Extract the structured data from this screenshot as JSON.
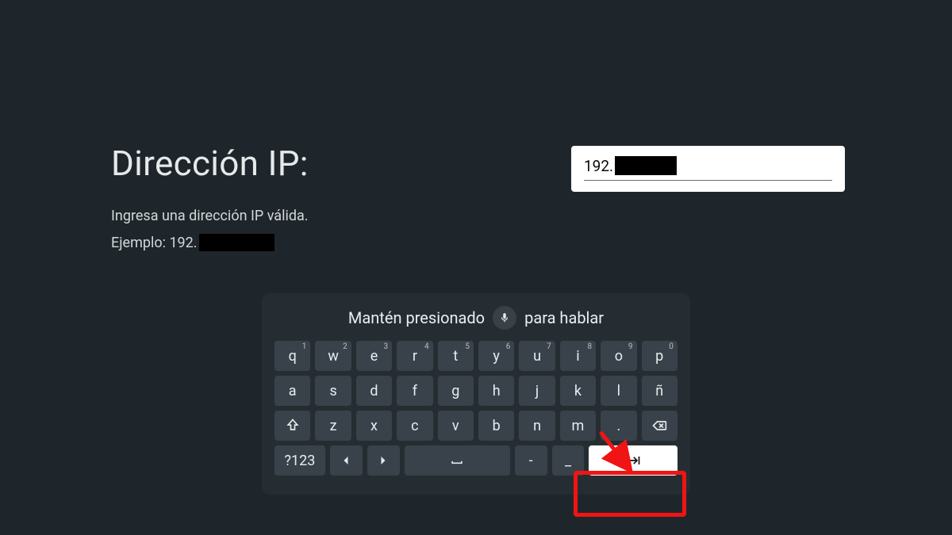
{
  "title": "Dirección IP:",
  "hint": "Ingresa una dirección IP válida.",
  "example_prefix": "Ejemplo: 192.",
  "input": {
    "value_visible": "192."
  },
  "keyboard": {
    "voice_hint_before": "Mantén presionado",
    "voice_hint_after": "para hablar",
    "row1": [
      {
        "l": "q",
        "s": "1"
      },
      {
        "l": "w",
        "s": "2"
      },
      {
        "l": "e",
        "s": "3"
      },
      {
        "l": "r",
        "s": "4"
      },
      {
        "l": "t",
        "s": "5"
      },
      {
        "l": "y",
        "s": "6"
      },
      {
        "l": "u",
        "s": "7"
      },
      {
        "l": "i",
        "s": "8"
      },
      {
        "l": "o",
        "s": "9"
      },
      {
        "l": "p",
        "s": "0"
      }
    ],
    "row2": [
      "a",
      "s",
      "d",
      "f",
      "g",
      "h",
      "j",
      "k",
      "l",
      "ñ"
    ],
    "row3_letters": [
      "z",
      "x",
      "c",
      "v",
      "b",
      "n",
      "m"
    ],
    "row3_period": ".",
    "row4": {
      "nums_label": "?123",
      "hyphen": "-",
      "underscore": "_"
    }
  }
}
